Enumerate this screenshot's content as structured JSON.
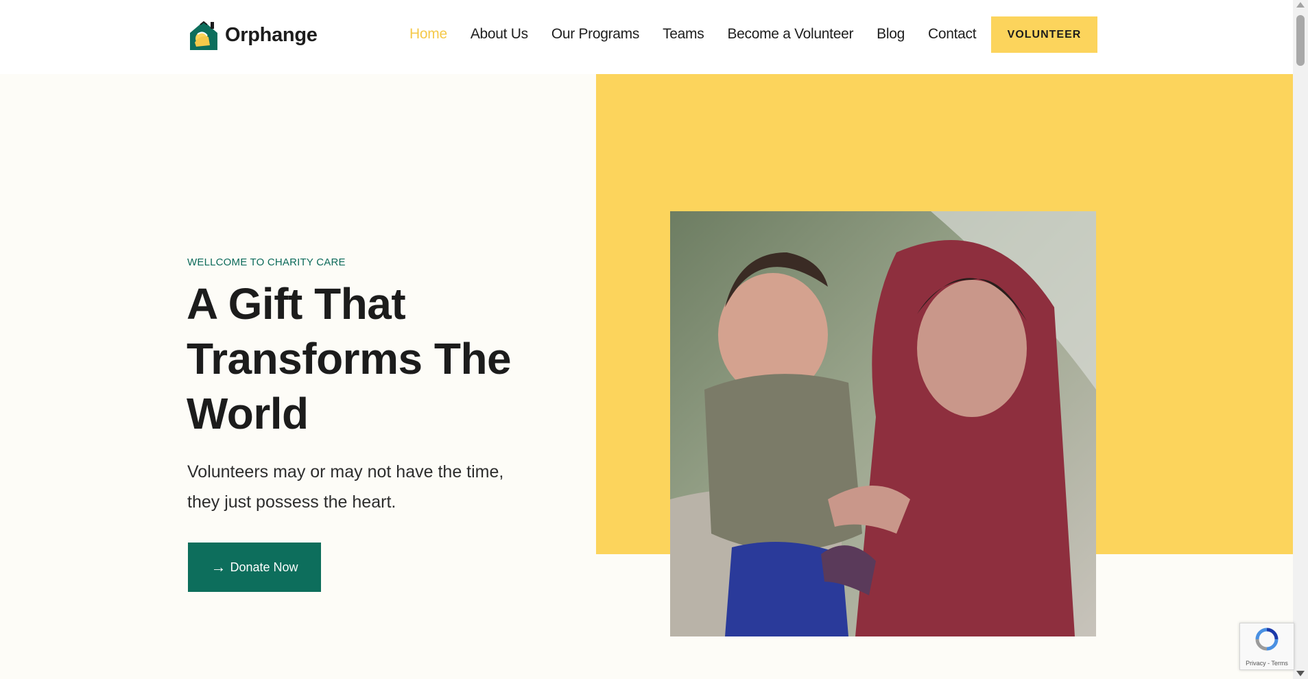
{
  "brand": {
    "name": "Orphange",
    "logo_icon": "house-hands-icon"
  },
  "nav": {
    "items": [
      {
        "label": "Home",
        "active": true
      },
      {
        "label": "About Us"
      },
      {
        "label": "Our Programs"
      },
      {
        "label": "Teams"
      },
      {
        "label": "Become a Volunteer"
      },
      {
        "label": "Blog"
      },
      {
        "label": "Contact"
      }
    ],
    "cta_label": "VOLUNTEER"
  },
  "hero": {
    "eyebrow": "WELLCOME TO CHARITY CARE",
    "headline": "A Gift That Transforms The World",
    "subtext": "Volunteers may or may not have the time, they just possess the heart.",
    "donate_label": "Donate Now",
    "donate_icon": "arrow-right-icon"
  },
  "recaptcha": {
    "links": "Privacy - Terms"
  },
  "colors": {
    "accent": "#fcd45c",
    "brand_green": "#0d6e5c",
    "nav_active": "#f5c94a",
    "text": "#1c1c1c"
  }
}
